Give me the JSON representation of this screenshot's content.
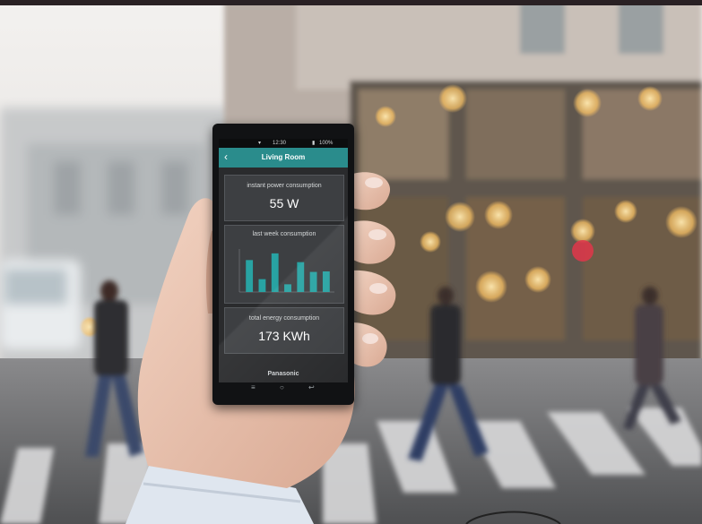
{
  "status_bar": {
    "time": "12:30",
    "battery": "100%"
  },
  "app": {
    "title": "Living Room",
    "back_icon": "chevron-left-icon"
  },
  "cards": {
    "instant": {
      "label": "instant power consumption",
      "value": "55 W"
    },
    "weekly": {
      "label": "last week consumption"
    },
    "total": {
      "label": "total energy consumption",
      "value": "173 KWh"
    }
  },
  "brand": "Panasonic",
  "nav_icons": [
    "menu-icon",
    "home-icon",
    "back-icon"
  ],
  "colors": {
    "accent": "#2a8c8c",
    "bar": "#28a3a3",
    "screen_bg": "#2a2b2d"
  },
  "chart_data": {
    "type": "bar",
    "categories": [
      "",
      "",
      "",
      "",
      "",
      "",
      ""
    ],
    "values": [
      6.2,
      2.5,
      7.5,
      1.5,
      5.8,
      3.9,
      4.0
    ],
    "title": "last week consumption",
    "xlabel": "",
    "ylabel": "",
    "ylim": [
      0,
      8
    ]
  }
}
